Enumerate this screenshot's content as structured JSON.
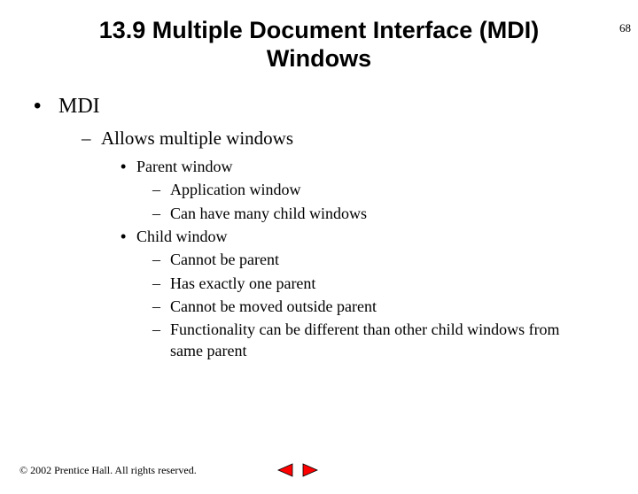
{
  "slide_number": "68",
  "title": "13.9   Multiple Document Interface (MDI) Windows",
  "outline": {
    "l1": {
      "bullet": "•",
      "text": "MDI"
    },
    "l2": {
      "bullet": "–",
      "text": "Allows multiple windows"
    },
    "l3a": {
      "bullet": "•",
      "text": "Parent window"
    },
    "l4a1": {
      "bullet": "–",
      "text": "Application window"
    },
    "l4a2": {
      "bullet": "–",
      "text": "Can have many child windows"
    },
    "l3b": {
      "bullet": "•",
      "text": "Child window"
    },
    "l4b1": {
      "bullet": "–",
      "text": "Cannot be parent"
    },
    "l4b2": {
      "bullet": "–",
      "text": "Has exactly one parent"
    },
    "l4b3": {
      "bullet": "–",
      "text": "Cannot be moved outside parent"
    },
    "l4b4": {
      "bullet": "–",
      "text": "Functionality can be different than other child windows from same parent"
    }
  },
  "copyright": "© 2002 Prentice Hall. All rights reserved.",
  "colors": {
    "arrow_fill": "#ff0000",
    "arrow_stroke": "#000000"
  }
}
